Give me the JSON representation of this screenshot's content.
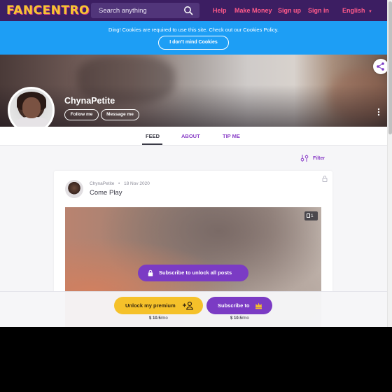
{
  "topnav": {
    "logo": "FANCENTRO",
    "search_placeholder": "Search anything",
    "links": [
      "Help",
      "Make Money",
      "Sign up",
      "Sign in"
    ],
    "language": "English"
  },
  "cookie": {
    "message": "Ding! Cookies are required to use this site. Check out our Cookies Policy.",
    "button": "I don't mind Cookies"
  },
  "profile": {
    "name": "ChynaPetite",
    "follow_label": "Follow me",
    "message_label": "Message me"
  },
  "tabs": [
    "FEED",
    "ABOUT",
    "TIP ME"
  ],
  "filter_label": "Filter",
  "post": {
    "author": "ChynaPetite",
    "separator": "•",
    "date": "18 Nov 2020",
    "title": "Come Play",
    "media_count": "1",
    "unlock_label": "Subscribe to unlock all posts"
  },
  "subscribe_bar": {
    "premium_label": "Unlock my premium",
    "premium_price": "$ 10.5",
    "premium_period": "/mo",
    "subscribe_label": "Subscribe to",
    "subscribe_price": "$ 10.5",
    "subscribe_period": "/mo"
  },
  "colors": {
    "nav_bg": "#3c1e62",
    "nav_link": "#ff5a8a",
    "cookie_bg": "#1d9ef5",
    "accent_purple": "#7b3bc4",
    "premium_yellow": "#f5c12a"
  }
}
